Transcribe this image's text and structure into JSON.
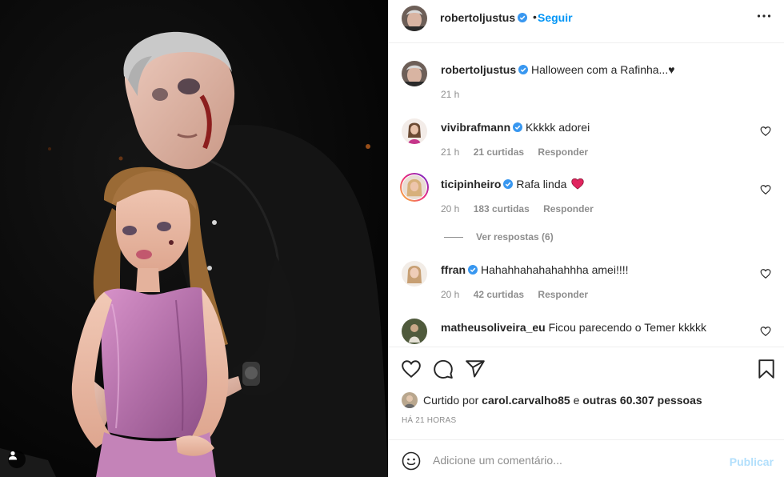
{
  "post": {
    "author": "robertoljustus",
    "follow_label": "Seguir",
    "dot": "•",
    "caption": "Halloween com a Rafinha...♥",
    "caption_time": "21 h",
    "likes_prefix": "Curtido por",
    "likes_user": "carol.carvalho85",
    "likes_middle": "e",
    "likes_count": "outras 60.307 pessoas",
    "posted_ago": "HÁ 21 HORAS"
  },
  "comments": [
    {
      "user": "vivibrafmann",
      "verified": true,
      "text": "Kkkkk adorei",
      "time": "21 h",
      "likes": "21 curtidas",
      "reply": "Responder"
    },
    {
      "user": "ticipinheiro",
      "verified": true,
      "text": "Rafa linda",
      "emoji": "heart",
      "time": "20 h",
      "likes": "183 curtidas",
      "reply": "Responder",
      "view_replies": "Ver respostas (6)"
    },
    {
      "user": "ffran",
      "verified": true,
      "text": "Hahahhahahahahhha amei!!!!",
      "time": "20 h",
      "likes": "42 curtidas",
      "reply": "Responder"
    },
    {
      "user": "matheusoliveira_eu",
      "verified": false,
      "text": "Ficou parecendo o Temer kkkkk"
    }
  ],
  "add_comment": {
    "placeholder": "Adicione um comentário...",
    "publish": "Publicar"
  },
  "icons": {
    "header_more": "more-horizontal-icon",
    "like": "heart-outline-icon",
    "comment": "comment-bubble-icon",
    "share": "paper-plane-icon",
    "save": "bookmark-icon",
    "emoji": "smiley-icon",
    "tag": "user-tag-icon"
  },
  "colors": {
    "link": "#0095f6",
    "verified": "#3897f0",
    "muted": "#8e8e8e",
    "publish_disabled": "#b2dffc",
    "heart_emoji": "#e0245e"
  }
}
